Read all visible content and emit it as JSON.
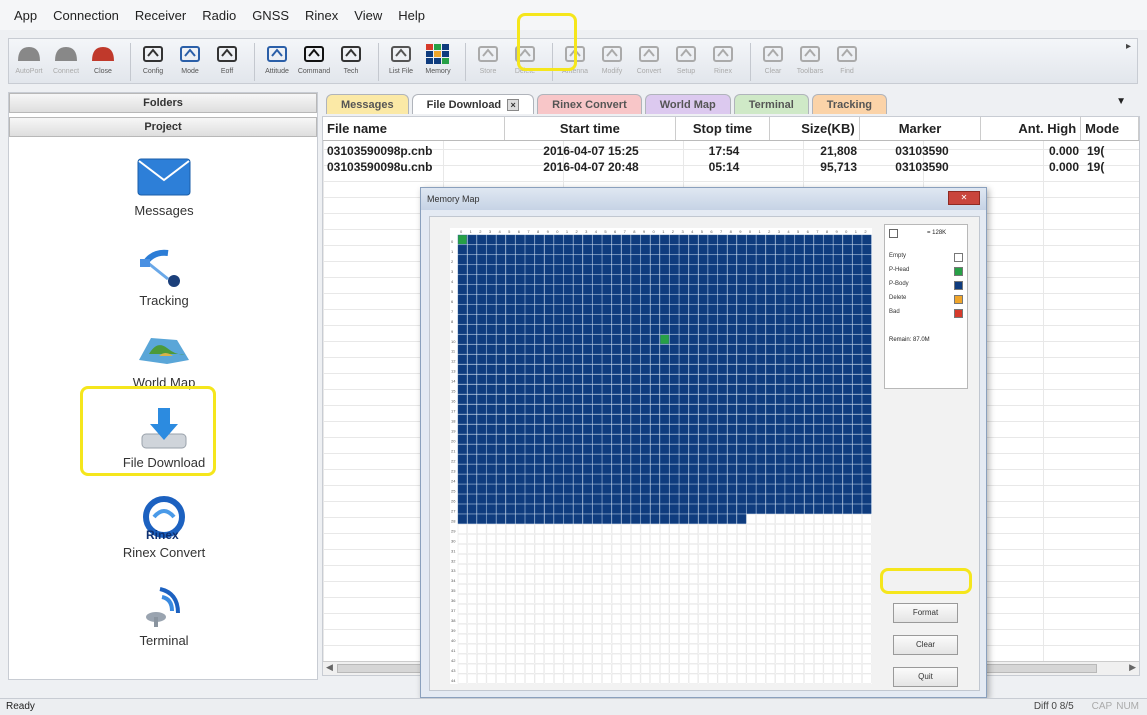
{
  "menu": [
    "App",
    "Connection",
    "Receiver",
    "Radio",
    "GNSS",
    "Rinex",
    "View",
    "Help"
  ],
  "toolbar": [
    {
      "label": "AutoPort",
      "icon": "connect-icon",
      "color": "#888888",
      "disabled": true
    },
    {
      "label": "Connect",
      "icon": "connect-icon",
      "color": "#888888",
      "disabled": true
    },
    {
      "label": "Close",
      "icon": "close-port-icon",
      "color": "#c0392b",
      "disabled": false
    },
    {
      "label": "Config",
      "icon": "config-tool-icon",
      "color": "#333333",
      "disabled": false
    },
    {
      "label": "Mode",
      "icon": "mode-icon",
      "color": "#2b5fa8",
      "disabled": false
    },
    {
      "label": "Eoff",
      "icon": "eoff-icon",
      "color": "#333333",
      "disabled": false
    },
    {
      "label": "Attitude",
      "icon": "attitude-icon",
      "color": "#2b5fa8",
      "disabled": false
    },
    {
      "label": "Command",
      "icon": "command-icon",
      "color": "#111111",
      "disabled": false
    },
    {
      "label": "Tech",
      "icon": "tech-icon",
      "color": "#333333",
      "disabled": false
    },
    {
      "label": "List File",
      "icon": "list-file-icon",
      "color": "#555555",
      "disabled": false
    },
    {
      "label": "Memory",
      "icon": "memory-icon",
      "color": "#1b4f8e",
      "disabled": false
    },
    {
      "label": "Store",
      "icon": "save-icon",
      "color": "#aaaaaa",
      "disabled": true
    },
    {
      "label": "Delete",
      "icon": "delete-icon",
      "color": "#aaaaaa",
      "disabled": true
    },
    {
      "label": "Antenna",
      "icon": "antenna-icon",
      "color": "#aaaaaa",
      "disabled": true
    },
    {
      "label": "Modify",
      "icon": "modify-icon",
      "color": "#aaaaaa",
      "disabled": true
    },
    {
      "label": "Convert",
      "icon": "convert-icon",
      "color": "#aaaaaa",
      "disabled": true
    },
    {
      "label": "Setup",
      "icon": "setup-icon",
      "color": "#aaaaaa",
      "disabled": true
    },
    {
      "label": "Rinex",
      "icon": "rinex-icon",
      "color": "#aaaaaa",
      "disabled": true
    },
    {
      "label": "Clear",
      "icon": "clear-icon",
      "color": "#aaaaaa",
      "disabled": true
    },
    {
      "label": "Toolbars",
      "icon": "toolbars-icon",
      "color": "#aaaaaa",
      "disabled": true
    },
    {
      "label": "Find",
      "icon": "find-icon",
      "color": "#aaaaaa",
      "disabled": true
    }
  ],
  "left_panel": {
    "folders_label": "Folders",
    "project_label": "Project",
    "items": [
      {
        "label": "Messages",
        "icon": "envelope-icon"
      },
      {
        "label": "Tracking",
        "icon": "satellite-icon"
      },
      {
        "label": "World Map",
        "icon": "world-map-icon"
      },
      {
        "label": "File Download",
        "icon": "download-icon"
      },
      {
        "label": "Rinex Convert",
        "icon": "rinex-icon"
      },
      {
        "label": "Terminal",
        "icon": "terminal-icon"
      }
    ]
  },
  "tabs": [
    {
      "label": "Messages"
    },
    {
      "label": "File Download",
      "active": true
    },
    {
      "label": "Rinex Convert"
    },
    {
      "label": "World Map"
    },
    {
      "label": "Terminal"
    },
    {
      "label": "Tracking"
    }
  ],
  "table": {
    "columns": [
      "File name",
      "Start time",
      "Stop time",
      "Size(KB)",
      "Marker",
      "Ant. High",
      "Mode"
    ],
    "rows": [
      [
        "03103590098p.cnb",
        "2016-04-07 15:25",
        "17:54",
        "21,808",
        "03103590",
        "0.000",
        "19("
      ],
      [
        "03103590098u.cnb",
        "2016-04-07 20:48",
        "05:14",
        "95,713",
        "03103590",
        "0.000",
        "19("
      ]
    ]
  },
  "memory_dialog": {
    "title": "Memory Map",
    "columns": 43,
    "rows": 45,
    "used_full_rows": 28,
    "used_last_row_cols": 30,
    "written_cells": [
      [
        0,
        0
      ],
      [
        10,
        21
      ]
    ],
    "colors": {
      "empty": "#ffffff",
      "written": "#27a046",
      "full": "#0f3c7e",
      "delete": "#f0a52a",
      "bad": "#d63a2b"
    },
    "legend": [
      {
        "label": "Empty",
        "color": "#ffffff"
      },
      {
        "label": "P-Head",
        "color": "#27a046"
      },
      {
        "label": "P-Body",
        "color": "#0f3c7e"
      },
      {
        "label": "Delete",
        "color": "#f0a52a"
      },
      {
        "label": "Bad",
        "color": "#d63a2b"
      }
    ],
    "remain_label": "Remain: 87.0M",
    "block_note": "= 128K",
    "buttons": {
      "format": "Format",
      "clear": "Clear",
      "quit": "Quit"
    }
  },
  "status": {
    "ready": "Ready",
    "diff": "Diff 0 8/5",
    "cap": "CAP",
    "num": "NUM"
  }
}
